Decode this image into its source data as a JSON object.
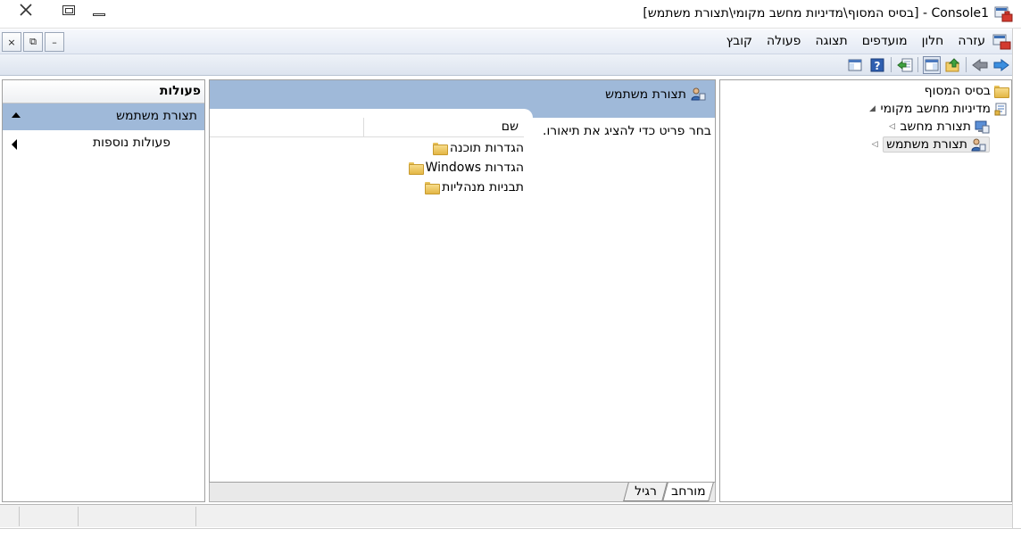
{
  "window": {
    "title": "Console1 - [בסיס המסוף\\מדיניות מחשב מקומי\\תצורת משתמש]"
  },
  "menu": {
    "items": [
      "קובץ",
      "פעולה",
      "תצוגה",
      "מועדפים",
      "חלון",
      "עזרה"
    ]
  },
  "mdi_buttons": {
    "close": "×",
    "restore": "⧉",
    "minimize": "–"
  },
  "tree": {
    "root": "בסיס המסוף",
    "policy": "מדיניות מחשב מקומי",
    "computer_config": "תצורת מחשב",
    "user_config": "תצורת משתמש"
  },
  "center": {
    "header_title": "תצורת משתמש",
    "description": "בחר פריט כדי להציג את תיאורו.",
    "column_name": "שם",
    "items": [
      "הגדרות תוכנה",
      "הגדרות Windows",
      "תבניות מנהליות"
    ],
    "tabs": {
      "extended": "מורחב",
      "standard": "רגיל"
    }
  },
  "actions": {
    "title": "פעולות",
    "group": "תצורת משתמש",
    "more": "פעולות נוספות"
  },
  "colors": {
    "header_blue": "#9fb9d9",
    "folder_yellow": "#e3b645"
  }
}
